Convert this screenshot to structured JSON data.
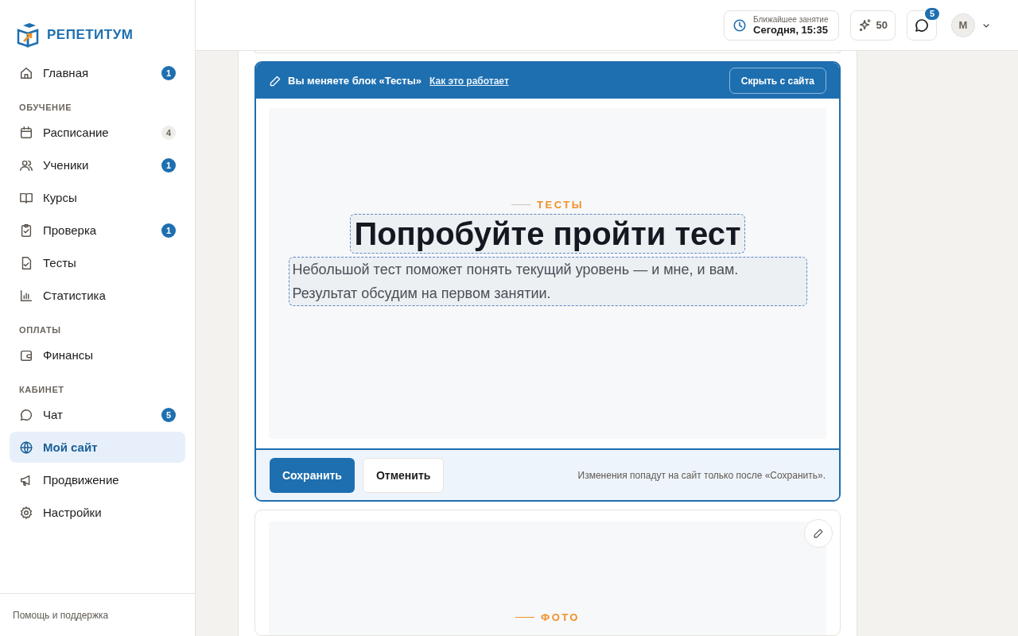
{
  "brand": {
    "name": "РЕПЕТИТУМ"
  },
  "sidebar": {
    "sections": [
      {
        "items": [
          {
            "label": "Главная",
            "kind": "home",
            "badge": "1",
            "badge_highlighted": true,
            "selected": false
          }
        ]
      },
      {
        "heading": "ОБУЧЕНИЕ",
        "items": [
          {
            "label": "Расписание",
            "kind": "calendar",
            "badge": "4",
            "badge_highlighted": false,
            "selected": false
          },
          {
            "label": "Ученики",
            "kind": "users",
            "badge": "1",
            "badge_highlighted": true,
            "selected": false
          },
          {
            "label": "Курсы",
            "kind": "book",
            "selected": false
          },
          {
            "label": "Проверка",
            "kind": "clipboard",
            "badge": "1",
            "badge_highlighted": true,
            "selected": false
          },
          {
            "label": "Тесты",
            "kind": "file",
            "selected": false
          },
          {
            "label": "Статистика",
            "kind": "chart",
            "selected": false
          }
        ]
      },
      {
        "heading": "ОПЛАТЫ",
        "items": [
          {
            "label": "Финансы",
            "kind": "wallet",
            "selected": false
          }
        ]
      },
      {
        "heading": "КАБИНЕТ",
        "items": [
          {
            "label": "Чат",
            "kind": "chat",
            "badge": "5",
            "badge_highlighted": true,
            "selected": false
          },
          {
            "label": "Мой сайт",
            "kind": "globe",
            "selected": true
          },
          {
            "label": "Продвижение",
            "kind": "megaphone",
            "selected": false
          },
          {
            "label": "Настройки",
            "kind": "gear",
            "selected": false
          }
        ]
      }
    ],
    "footer_link": "Помощь и поддержка"
  },
  "topbar": {
    "next_lesson": {
      "label": "Ближайшее занятие",
      "value": "Сегодня, 15:35"
    },
    "points": "50",
    "chat_badge": "5",
    "avatar": "М"
  },
  "editor": {
    "title": "Вы меняете блок «Тесты»",
    "help_link": "Как это работает",
    "hide_button": "Скрыть с сайта",
    "eyebrow": "ТЕСТЫ",
    "heading": "Попробуйте пройти тест",
    "text": "Небольшой тест поможет понять текущий уровень — и мне, и вам.\nРезультат обсудим на первом занятии.",
    "save_button": "Сохранить",
    "cancel_button": "Отменить",
    "note": "Изменения попадут на сайт только после «Сохранить»."
  },
  "next_block": {
    "eyebrow": "ФОТО"
  }
}
